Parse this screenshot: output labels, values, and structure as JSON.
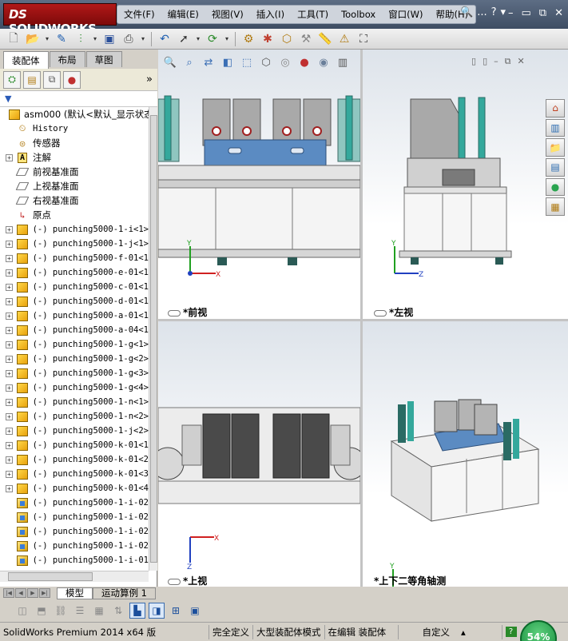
{
  "app": {
    "logo_prefix": "DS",
    "logo_text": "SOLIDWORKS",
    "menus": [
      "文件(F)",
      "编辑(E)",
      "视图(V)",
      "插入(I)",
      "工具(T)",
      "Toolbox",
      "窗口(W)",
      "帮助(H)"
    ],
    "help_tools": [
      "🔍",
      "...",
      "?",
      "▾"
    ],
    "window_controls": [
      "–",
      "▭",
      "⧉",
      "✕"
    ]
  },
  "toolbar_icons": [
    "new-document-icon",
    "open-folder-icon",
    "save-icon",
    "print-icon",
    "undo-icon",
    "select-icon",
    "rebuild-icon",
    "options-icon"
  ],
  "panel": {
    "tabs": [
      "装配体",
      "布局",
      "草图"
    ],
    "tool_icons": [
      "feature-manager-icon",
      "property-manager-icon",
      "configuration-manager-icon",
      "appearance-manager-icon"
    ],
    "expand_label": "»",
    "filter_label": "▼",
    "tree": [
      {
        "expand": "",
        "icon": "assembly",
        "label": "asm000  (默认<默认_显示状态",
        "cn": true
      },
      {
        "expand": "",
        "icon": "history",
        "label": "History",
        "cn": false,
        "indent": 1
      },
      {
        "expand": "",
        "icon": "sensor",
        "label": "传感器",
        "cn": true,
        "indent": 1
      },
      {
        "expand": "+",
        "icon": "annotation",
        "label": "注解",
        "cn": true,
        "indent": 1
      },
      {
        "expand": "",
        "icon": "plane",
        "label": "前视基准面",
        "cn": true,
        "indent": 1
      },
      {
        "expand": "",
        "icon": "plane",
        "label": "上视基准面",
        "cn": true,
        "indent": 1
      },
      {
        "expand": "",
        "icon": "plane",
        "label": "右视基准面",
        "cn": true,
        "indent": 1
      },
      {
        "expand": "",
        "icon": "origin",
        "label": "原点",
        "cn": true,
        "indent": 1
      },
      {
        "expand": "+",
        "icon": "subasm",
        "label": "(-) punching5000-1-i<1>",
        "cn": false
      },
      {
        "expand": "+",
        "icon": "subasm",
        "label": "(-) punching5000-1-j<1>",
        "cn": false
      },
      {
        "expand": "+",
        "icon": "subasm",
        "label": "(-) punching5000-f-01<1",
        "cn": false
      },
      {
        "expand": "+",
        "icon": "subasm",
        "label": "(-) punching5000-e-01<1",
        "cn": false
      },
      {
        "expand": "+",
        "icon": "subasm",
        "label": "(-) punching5000-c-01<1",
        "cn": false
      },
      {
        "expand": "+",
        "icon": "subasm",
        "label": "(-) punching5000-d-01<1",
        "cn": false
      },
      {
        "expand": "+",
        "icon": "subasm",
        "label": "(-) punching5000-a-01<1",
        "cn": false
      },
      {
        "expand": "+",
        "icon": "subasm",
        "label": "(-) punching5000-a-04<1",
        "cn": false
      },
      {
        "expand": "+",
        "icon": "subasm",
        "label": "(-) punching5000-1-g<1>",
        "cn": false
      },
      {
        "expand": "+",
        "icon": "subasm",
        "label": "(-) punching5000-1-g<2>",
        "cn": false
      },
      {
        "expand": "+",
        "icon": "subasm",
        "label": "(-) punching5000-1-g<3>",
        "cn": false
      },
      {
        "expand": "+",
        "icon": "subasm",
        "label": "(-) punching5000-1-g<4>",
        "cn": false
      },
      {
        "expand": "+",
        "icon": "subasm",
        "label": "(-) punching5000-1-n<1>",
        "cn": false
      },
      {
        "expand": "+",
        "icon": "subasm",
        "label": "(-) punching5000-1-n<2>",
        "cn": false
      },
      {
        "expand": "+",
        "icon": "subasm",
        "label": "(-) punching5000-1-j<2>",
        "cn": false
      },
      {
        "expand": "+",
        "icon": "subasm",
        "label": "(-) punching5000-k-01<1",
        "cn": false
      },
      {
        "expand": "+",
        "icon": "subasm",
        "label": "(-) punching5000-k-01<2",
        "cn": false
      },
      {
        "expand": "+",
        "icon": "subasm",
        "label": "(-) punching5000-k-01<3",
        "cn": false
      },
      {
        "expand": "+",
        "icon": "subasm",
        "label": "(-) punching5000-k-01<4",
        "cn": false
      },
      {
        "expand": "",
        "icon": "part",
        "label": "(-) punching5000-1-i-02",
        "cn": false
      },
      {
        "expand": "",
        "icon": "part",
        "label": "(-) punching5000-1-i-02",
        "cn": false
      },
      {
        "expand": "",
        "icon": "part",
        "label": "(-) punching5000-1-i-02",
        "cn": false
      },
      {
        "expand": "",
        "icon": "part",
        "label": "(-) punching5000-1-i-02",
        "cn": false
      },
      {
        "expand": "",
        "icon": "part",
        "label": "(-) punching5000-1-i-01",
        "cn": false
      }
    ],
    "bottom_tabs": [
      "模型",
      "运动算例 1"
    ]
  },
  "viewports": {
    "front": {
      "label": "*前视"
    },
    "left": {
      "label": "*左视"
    },
    "top": {
      "label": "*上视"
    },
    "iso": {
      "label": "*上下二等角轴测"
    },
    "axis_x": "X",
    "axis_y": "Y",
    "axis_z": "Z"
  },
  "right_panel_icons": [
    "home-icon",
    "design-library-icon",
    "file-explorer-icon",
    "view-palette-icon",
    "appearances-icon",
    "custom-properties-icon"
  ],
  "status": {
    "product": "SolidWorks Premium 2014 x64 版",
    "fully_defined": "完全定义",
    "large_assembly": "大型装配体模式",
    "editing": "在编辑 装配体",
    "custom": "自定义",
    "help": "?",
    "progress_label": "54%",
    "progress_value": 0.54
  },
  "colors": {
    "title_bar": "#4a5870",
    "logo_red": "#a41414",
    "machine_blue": "#5b8bc2",
    "machine_gray": "#9c9c9c",
    "machine_teal": "#34a89c",
    "gauge_green": "#2aa44f"
  }
}
